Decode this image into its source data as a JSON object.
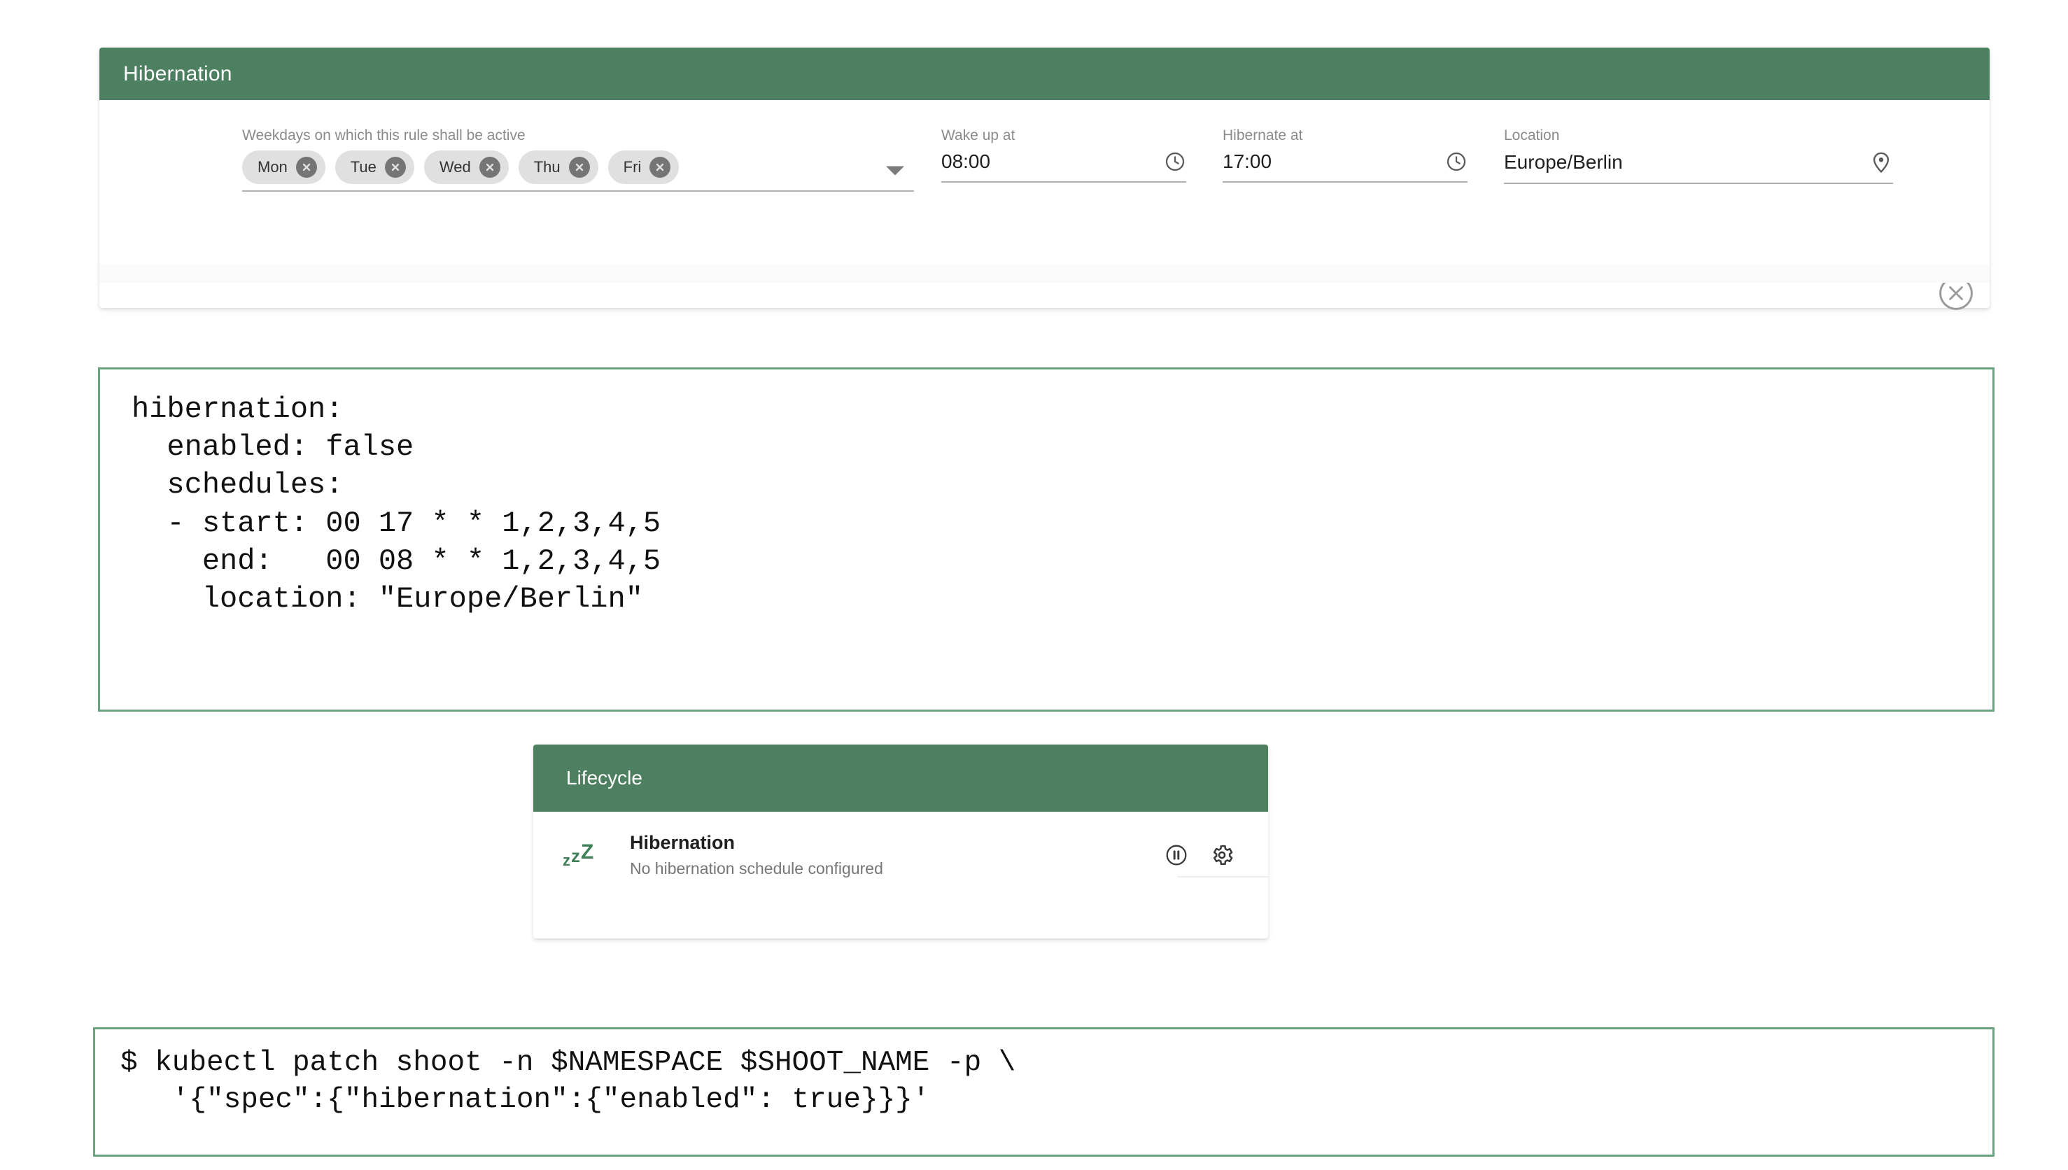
{
  "hibernation_card": {
    "header_title": "Hibernation",
    "weekdays": {
      "label": "Weekdays on which this rule shall be active",
      "chips": [
        {
          "label": "Mon",
          "remove_icon": "close-circle-icon"
        },
        {
          "label": "Tue",
          "remove_icon": "close-circle-icon"
        },
        {
          "label": "Wed",
          "remove_icon": "close-circle-icon"
        },
        {
          "label": "Thu",
          "remove_icon": "close-circle-icon"
        },
        {
          "label": "Fri",
          "remove_icon": "close-circle-icon"
        }
      ],
      "dropdown_icon": "chevron-down-icon"
    },
    "wake_up": {
      "label": "Wake up at",
      "value": "08:00",
      "icon": "clock-icon"
    },
    "hibernate": {
      "label": "Hibernate at",
      "value": "17:00",
      "icon": "clock-icon"
    },
    "location": {
      "label": "Location",
      "value": "Europe/Berlin",
      "icon": "map-pin-icon"
    },
    "remove_rule_icon": "close-circle-outline-icon"
  },
  "yaml_block": {
    "lines": [
      "hibernation:",
      "  enabled: false",
      "  schedules:",
      "  - start: 00 17 * * 1,2,3,4,5",
      "    end:   00 08 * * 1,2,3,4,5",
      "    location: \"Europe/Berlin\""
    ],
    "text": "hibernation:\n  enabled: false\n  schedules:\n  - start: 00 17 * * 1,2,3,4,5\n    end:   00 08 * * 1,2,3,4,5\n    location: \"Europe/Berlin\""
  },
  "lifecycle_card": {
    "header_title": "Lifecycle",
    "sleep_icon": "sleep-zzz-icon",
    "sleep_icon_letters": [
      "z",
      "z",
      "Z"
    ],
    "item_title": "Hibernation",
    "item_subtitle": "No hibernation schedule configured",
    "actions": [
      {
        "name": "pause-circle-icon"
      },
      {
        "name": "gear-icon"
      }
    ]
  },
  "command_block": {
    "lines": [
      "$ kubectl patch shoot -n $NAMESPACE $SHOOT_NAME -p \\",
      "   '{\"spec\":{\"hibernation\":{\"enabled\": true}}}'"
    ],
    "text": "$ kubectl patch shoot -n $NAMESPACE $SHOOT_NAME -p \\\n   '{\"spec\":{\"hibernation\":{\"enabled\": true}}}'"
  },
  "colors": {
    "brand_green": "#4c8060",
    "code_border_green": "#6aa37f",
    "chip_bg": "#e0e0e0",
    "chip_x_bg": "#757575",
    "label_gray": "#8b8b8b",
    "sleep_icon_green": "#3f8059"
  }
}
